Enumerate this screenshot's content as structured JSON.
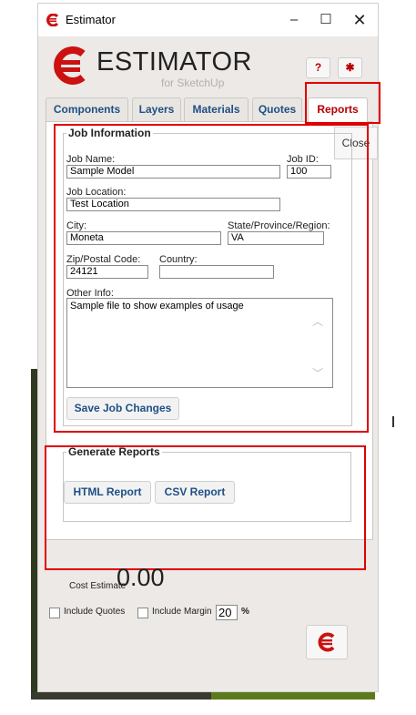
{
  "window": {
    "title": "Estimator",
    "minimize": "–",
    "maximize": "☐",
    "close": "✕"
  },
  "branding": {
    "name": "ESTIMATOR",
    "subtitle": "for SketchUp",
    "brand_color": "#cc1111"
  },
  "toolbar": {
    "help": "?",
    "settings": "✱"
  },
  "tabs": [
    {
      "label": "Components"
    },
    {
      "label": "Layers"
    },
    {
      "label": "Materials"
    },
    {
      "label": "Quotes"
    },
    {
      "label": "Reports",
      "active": true
    }
  ],
  "close_tab": "Close",
  "job": {
    "section_title": "Job Information",
    "job_name_label": "Job Name:",
    "job_name": "Sample Model",
    "job_id_label": "Job ID:",
    "job_id": "100",
    "location_label": "Job Location:",
    "location": "Test Location",
    "city_label": "City:",
    "city": "Moneta",
    "state_label": "State/Province/Region:",
    "state": "VA",
    "zip_label": "Zip/Postal Code:",
    "zip": "24121",
    "country_label": "Country:",
    "country": "",
    "other_label": "Other Info:",
    "other": "Sample file to show examples of usage",
    "save_button": "Save Job Changes"
  },
  "reports": {
    "section_title": "Generate Reports",
    "html_button": "HTML Report",
    "csv_button": "CSV Report"
  },
  "footer": {
    "cost_label": "Cost Estimate",
    "cost_value": "0.00",
    "include_quotes_label": "Include Quotes",
    "include_margin_label": "Include Margin",
    "margin_value": "20",
    "percent": "%"
  }
}
